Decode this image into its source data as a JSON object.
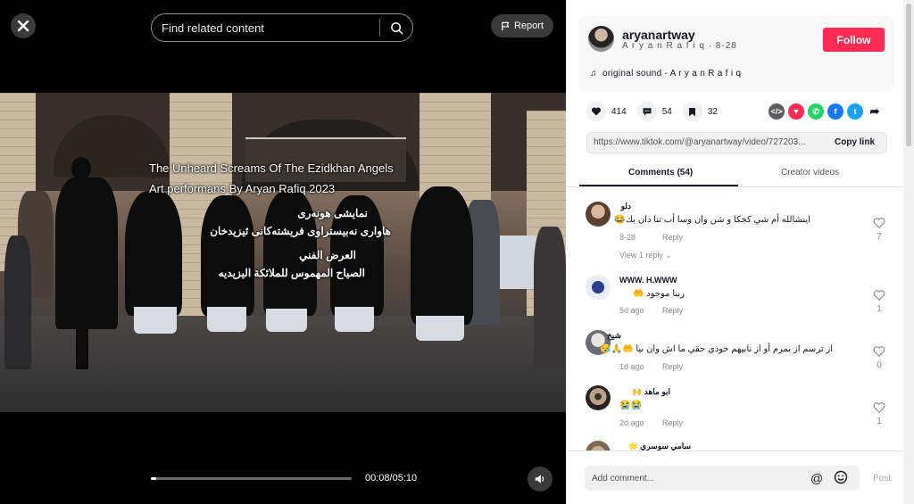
{
  "video": {
    "search_placeholder": "Find related content",
    "report_label": "Report",
    "overlay_line1": "The Unheard Screams Of The Ezidkhan  Angels",
    "overlay_line2": "Art performans  By Aryan Rafiq     2023",
    "overlay_ku1": "نمایشی هونەری",
    "overlay_ku2": "هاواری نەبیستراوی فریشتەکانی ئیزیدخان",
    "overlay_ar1": "العرض الفني",
    "overlay_ar2": "الصياح المهموس للملائكة اليزيديه",
    "time": "00:08/05:10",
    "progress": 0.026
  },
  "author": {
    "username": "aryanartway",
    "subline": "A r y a n R a f i q · 8-28",
    "follow_label": "Follow",
    "music": "original sound - A r y a n R a f i q"
  },
  "actions": {
    "likes": "414",
    "comments": "54",
    "saves": "32"
  },
  "share": {
    "url": "https://www.tiktok.com/@aryanartway/video/727203...",
    "copy_label": "Copy link",
    "icons": [
      "embed-icon",
      "send-icon",
      "whatsapp-icon",
      "facebook-icon",
      "twitter-icon",
      "share-arrow-icon"
    ]
  },
  "tabs": {
    "comments": "Comments (54)",
    "creator": "Creator videos"
  },
  "comments": [
    {
      "name": "دلو",
      "text": "اينشالله أم شي كجكا و شن وان وسا أب تنا دان يك😂",
      "date": "8-28",
      "reply": "Reply",
      "likes": "7"
    },
    {
      "name": "WWW. H.WWW",
      "text": "ربنا موجود 🤲",
      "date": "5d ago",
      "reply": "Reply",
      "likes": "1"
    },
    {
      "name": "شيخ",
      "text": "از ترسم از بمرم أو از نابيهم خودي حقي ما اش وان بيا 🤲🙏😪",
      "date": "1d ago",
      "reply": "Reply",
      "likes": "0"
    },
    {
      "name": "ابو ماهد   🙌",
      "text": "😭😭",
      "date": "2d ago",
      "reply": "Reply",
      "likes": "1"
    },
    {
      "name": "سامي سوسري 🌟",
      "text": "",
      "date": "",
      "reply": "",
      "likes": ""
    }
  ],
  "view_replies": "View 1 reply ⌄",
  "input": {
    "placeholder": "Add comment...",
    "post_label": "Post"
  },
  "colors": {
    "brand": "#fe2c55",
    "whatsapp": "#25d366",
    "facebook": "#1877f2",
    "twitter": "#1da1f2",
    "send": "#fe2c55"
  }
}
